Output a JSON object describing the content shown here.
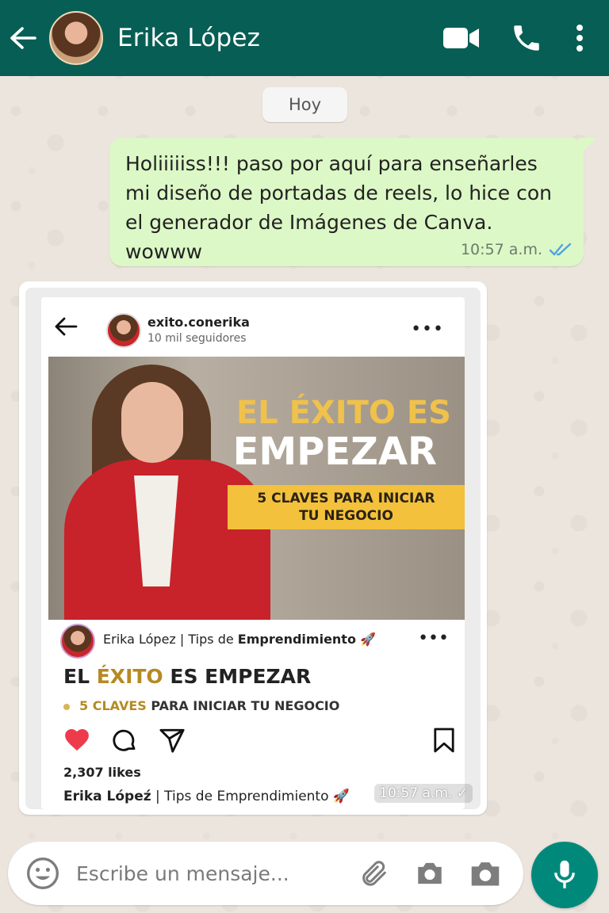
{
  "header": {
    "contact_name": "Erika López",
    "back_icon": "arrow-left-icon",
    "video_icon": "video-camera-icon",
    "call_icon": "phone-icon",
    "menu_icon": "more-vertical-icon",
    "color": "#075e54"
  },
  "chat": {
    "date_label": "Hoy",
    "outgoing": {
      "text": "Holiiiiiss!!! paso por aquí para enseñarles mi diseño de portadas de reels, lo hice con el generador de Imágenes de Canva. wowww",
      "time": "10:57 a.m.",
      "status_icon": "double-check-icon",
      "bubble_color": "#dcf8c6"
    },
    "incoming_image": {
      "time": "10:57 a.m.",
      "post": {
        "username": "exito.conerika",
        "followers": "10 mil seguidores",
        "image_headline_1": "EL ÉXITO ES",
        "image_headline_2": "EMPEZAR",
        "image_ribbon_1": "5 CLAVES PARA INICIAR",
        "image_ribbon_2": "TU NEGOCIO",
        "caption_name": "Erika López",
        "caption_sep": " | Tips de ",
        "caption_topic": "Emprendimiento",
        "caption_emoji": "🚀",
        "title_part1": "EL ",
        "title_part2": "ÉXITO",
        "title_part3": " ES EMPEZAR",
        "subtitle_part1": "5 CLAVES",
        "subtitle_part2": " PARA INICIAR TU NEGOCIO",
        "likes": "2,307 likes",
        "bottom_name": "Erika Lópeź",
        "bottom_rest": " | Tips de Emprendimiento",
        "bottom_emoji": "🚀"
      }
    }
  },
  "input": {
    "placeholder": "Escribe un mensaje...",
    "emoji_icon": "emoji-icon",
    "attach_icon": "paperclip-icon",
    "camera_icon": "camera-icon",
    "mic_icon": "microphone-icon",
    "mic_color": "#00897b"
  }
}
